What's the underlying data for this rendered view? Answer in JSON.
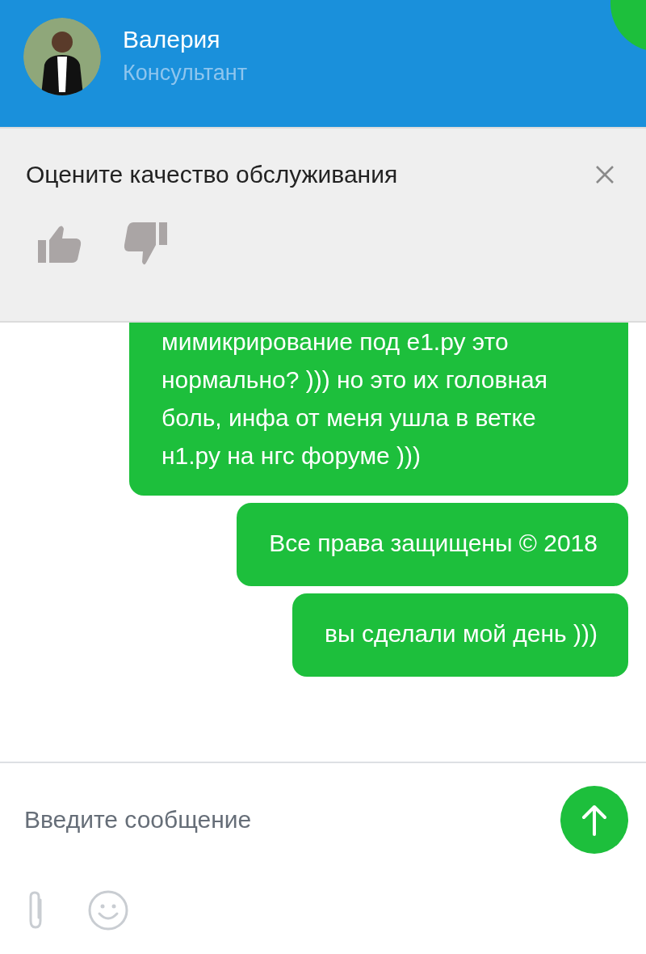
{
  "header": {
    "name": "Валерия",
    "role": "Консультант"
  },
  "rating": {
    "title": "Оцените качество обслуживания"
  },
  "messages": [
    {
      "text": "мимикрирование под е1.ру это нормально? ))) но это их головная боль, инфа от меня ушла в ветке н1.ру на нгс форуме )))"
    },
    {
      "text": "Все права защищены © 2018"
    },
    {
      "text": "вы сделали мой день )))"
    }
  ],
  "composer": {
    "placeholder": "Введите сообщение"
  }
}
